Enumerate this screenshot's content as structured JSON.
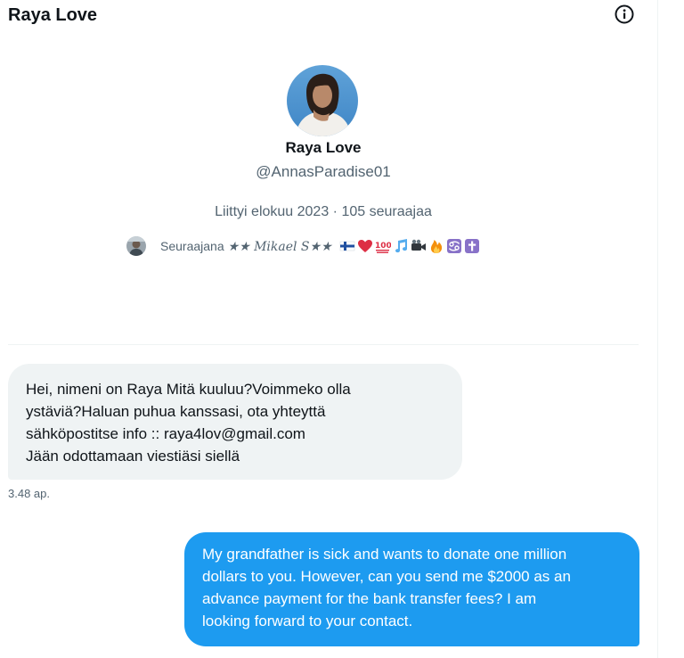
{
  "header": {
    "title": "Raya Love",
    "info_icon": "info-circle-icon"
  },
  "profile": {
    "name": "Raya Love",
    "handle": "@AnnasParadise01",
    "meta": "Liittyi elokuu 2023 · 105 seuraajaa",
    "followed_by": {
      "prefix": "Seuraajana",
      "name": "★★ 𝑀𝑖𝑘𝑎𝑒𝑙 𝑆★★",
      "emojis": [
        "finland-flag",
        "red-heart",
        "hundred-points",
        "musical-notes",
        "video-camera",
        "fire",
        "cancer-sign",
        "latin-cross"
      ]
    }
  },
  "messages": [
    {
      "direction": "incoming",
      "lines": [
        "Hei, nimeni on Raya Mitä kuuluu?Voimmeko olla",
        "ystäviä?Haluan puhua kanssasi, ota yhteyttä",
        "sähköpostitse info :: raya4lov@gmail.com",
        "Jään odottamaan viestiäsi siellä"
      ],
      "time": "3.48 ap."
    },
    {
      "direction": "outgoing",
      "lines": [
        "My grandfather is sick and wants to donate one million",
        "dollars to you. However, can you send me $2000 as an",
        "advance payment for the bank transfer fees? I am",
        "looking forward to your contact."
      ]
    }
  ],
  "colors": {
    "accent": "#1d9bf0",
    "incoming_bubble": "#eff3f4",
    "secondary_text": "#536471",
    "primary_text": "#0f1419"
  }
}
